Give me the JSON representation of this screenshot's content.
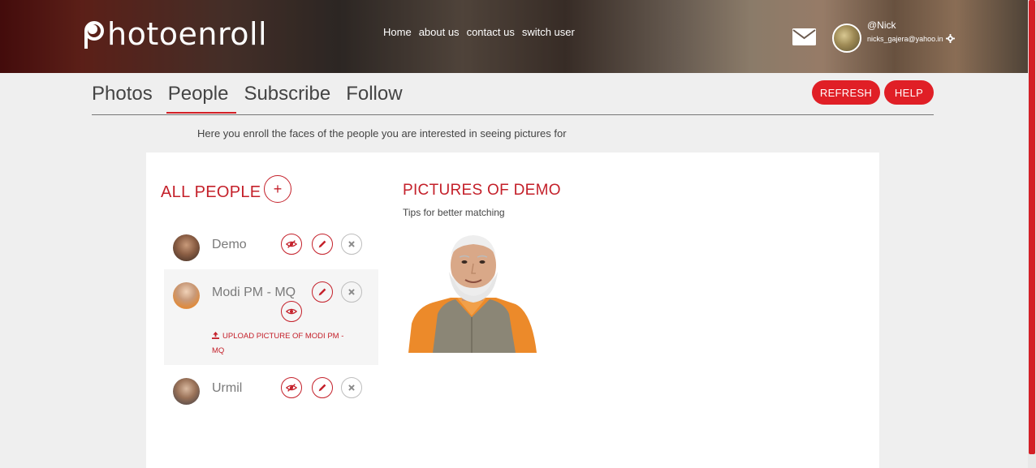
{
  "header": {
    "logo": "hotoenroll",
    "nav": [
      "Home",
      "about us",
      "contact us",
      "switch user"
    ],
    "user": {
      "name": "@Nick",
      "email": "nicks_gajera@yahoo.in"
    }
  },
  "tabs": [
    {
      "label": "Photos",
      "active": false
    },
    {
      "label": "People",
      "active": true
    },
    {
      "label": "Subscribe",
      "active": false
    },
    {
      "label": "Follow",
      "active": false
    }
  ],
  "actions": {
    "refresh": "REFRESH",
    "help": "HELP"
  },
  "intro": "Here you enroll the faces of the people you are interested in seeing pictures for",
  "people_panel": {
    "title": "ALL PEOPLE",
    "add_symbol": "+",
    "people": [
      {
        "name": "Demo"
      },
      {
        "name": "Modi PM - MQ",
        "upload_label": "UPLOAD PICTURE OF MODI PM - MQ"
      },
      {
        "name": "Urmil"
      }
    ]
  },
  "pictures_panel": {
    "title": "PICTURES OF DEMO",
    "tips": "Tips for better matching"
  },
  "colors": {
    "accent": "#d41f26",
    "text": "#444444",
    "muted": "#7a7a7a"
  }
}
